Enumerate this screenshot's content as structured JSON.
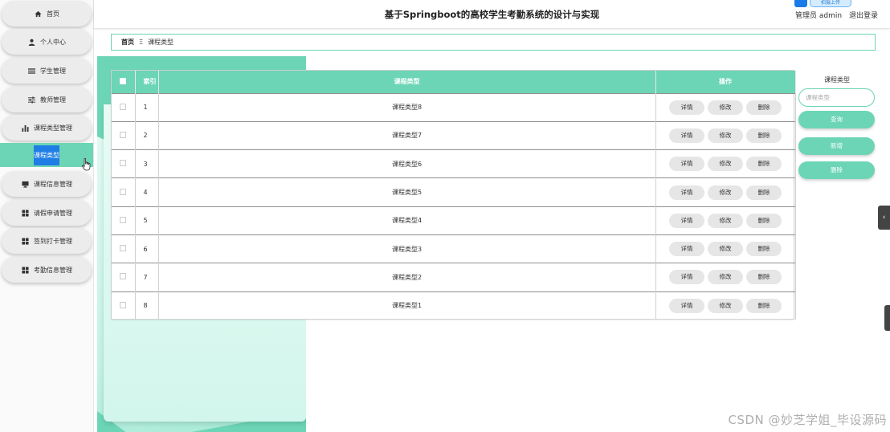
{
  "header": {
    "title": "基于Springboot的高校学生考勤系统的设计与实现",
    "user_role": "管理员 admin",
    "logout": "退出登录",
    "badge_label": "拍摄上传"
  },
  "sidebar": {
    "items": [
      {
        "label": "首页",
        "icon": "home-icon"
      },
      {
        "label": "个人中心",
        "icon": "user-icon"
      },
      {
        "label": "学生管理",
        "icon": "list-icon"
      },
      {
        "label": "教师管理",
        "icon": "sliders-icon"
      },
      {
        "label": "课程类型管理",
        "icon": "bar-chart-icon"
      },
      {
        "label": "课程类型",
        "icon": "",
        "active": true
      },
      {
        "label": "课程信息管理",
        "icon": "monitor-icon"
      },
      {
        "label": "请假申请管理",
        "icon": "grid-icon"
      },
      {
        "label": "签到打卡管理",
        "icon": "grid-icon"
      },
      {
        "label": "考勤信息管理",
        "icon": "grid-icon"
      }
    ]
  },
  "breadcrumb": {
    "home": "首页",
    "separator": "Ξ",
    "current": "课程类型"
  },
  "table": {
    "headers": {
      "index": "索引",
      "type": "课程类型",
      "actions": "操作"
    },
    "actions": {
      "detail": "详情",
      "edit": "修改",
      "delete": "删除"
    },
    "rows": [
      {
        "index": "1",
        "type": "课程类型8"
      },
      {
        "index": "2",
        "type": "课程类型7"
      },
      {
        "index": "3",
        "type": "课程类型6"
      },
      {
        "index": "4",
        "type": "课程类型5"
      },
      {
        "index": "5",
        "type": "课程类型4"
      },
      {
        "index": "6",
        "type": "课程类型3"
      },
      {
        "index": "7",
        "type": "课程类型2"
      },
      {
        "index": "8",
        "type": "课程类型1"
      }
    ]
  },
  "search": {
    "label": "课程类型",
    "placeholder": "课程类型",
    "query_btn": "查询",
    "add_btn": "新增",
    "delete_btn": "删除"
  },
  "watermark": "CSDN @妙芝学姐_毕设源码",
  "colors": {
    "accent": "#6cd5b5",
    "selected": "#1e7ee6"
  }
}
